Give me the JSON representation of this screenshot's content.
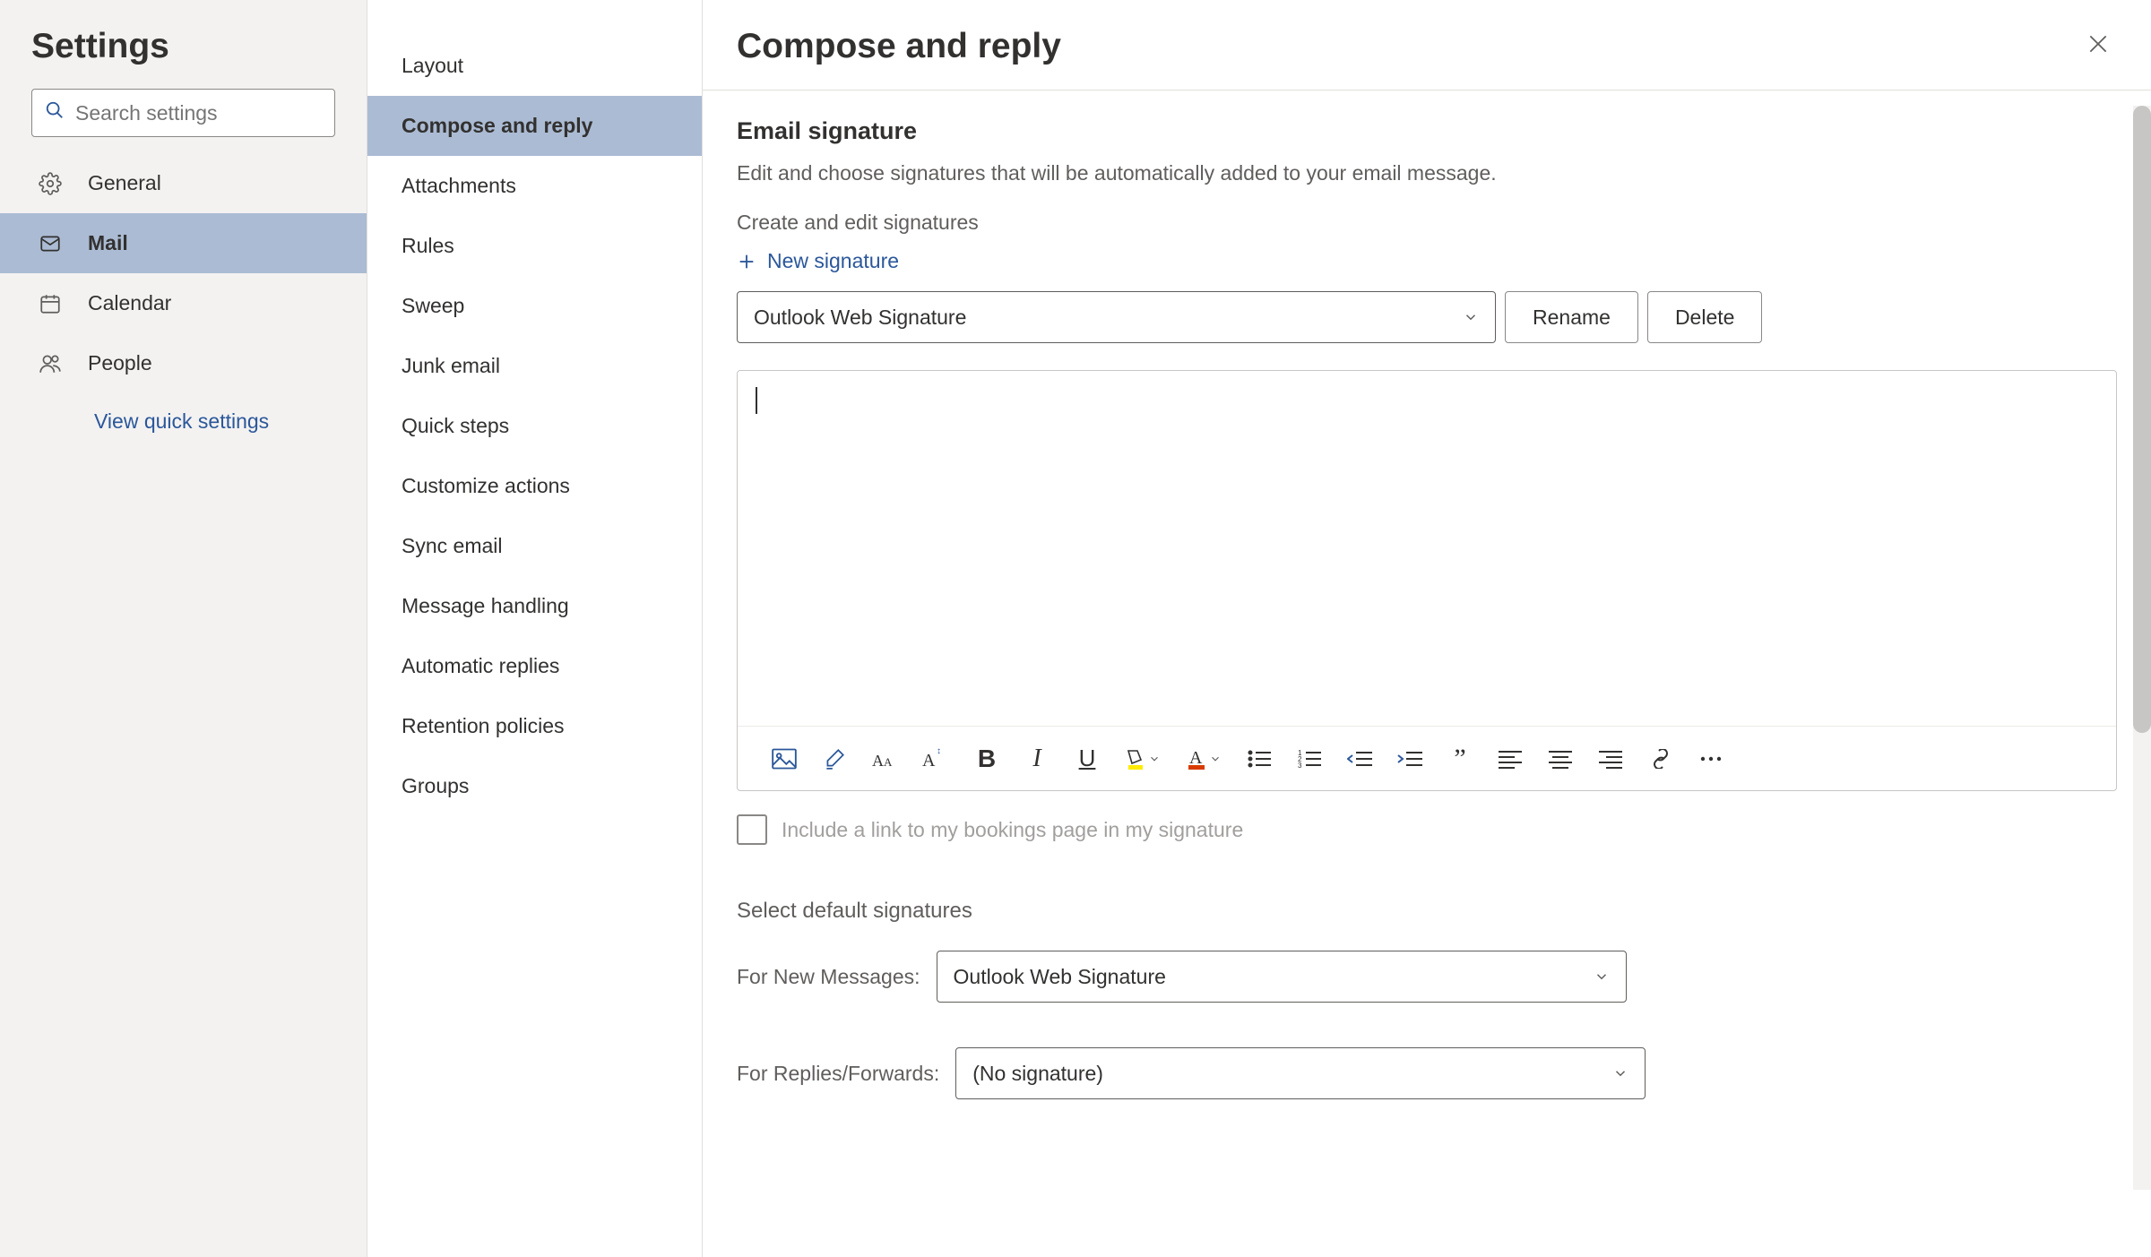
{
  "col1": {
    "title": "Settings",
    "search_placeholder": "Search settings",
    "nav": [
      {
        "label": "General",
        "icon": "gear"
      },
      {
        "label": "Mail",
        "icon": "mail",
        "active": true
      },
      {
        "label": "Calendar",
        "icon": "calendar"
      },
      {
        "label": "People",
        "icon": "people"
      }
    ],
    "quick_link": "View quick settings"
  },
  "col2": {
    "items": [
      "Layout",
      "Compose and reply",
      "Attachments",
      "Rules",
      "Sweep",
      "Junk email",
      "Quick steps",
      "Customize actions",
      "Sync email",
      "Message handling",
      "Automatic replies",
      "Retention policies",
      "Groups"
    ],
    "active_index": 1
  },
  "col3": {
    "title": "Compose and reply",
    "section_title": "Email signature",
    "section_desc": "Edit and choose signatures that will be automatically added to your email message.",
    "create_edit_label": "Create and edit signatures",
    "new_signature_label": "New signature",
    "signature_select_value": "Outlook Web Signature",
    "rename_label": "Rename",
    "delete_label": "Delete",
    "bookings_checkbox_label": "Include a link to my bookings page in my signature",
    "defaults_title": "Select default signatures",
    "for_new_label": "For New Messages:",
    "for_new_value": "Outlook Web Signature",
    "for_replies_label": "For Replies/Forwards:",
    "for_replies_value": "(No signature)"
  },
  "toolbar_icons": [
    "image-icon",
    "format-painter-icon",
    "font-family-icon",
    "font-size-icon",
    "bold-icon",
    "italic-icon",
    "underline-icon",
    "highlight-color-icon",
    "font-color-icon",
    "bullet-list-icon",
    "numbered-list-icon",
    "outdent-icon",
    "indent-icon",
    "quote-icon",
    "align-left-icon",
    "align-center-icon",
    "align-right-icon",
    "link-icon",
    "more-icon"
  ]
}
